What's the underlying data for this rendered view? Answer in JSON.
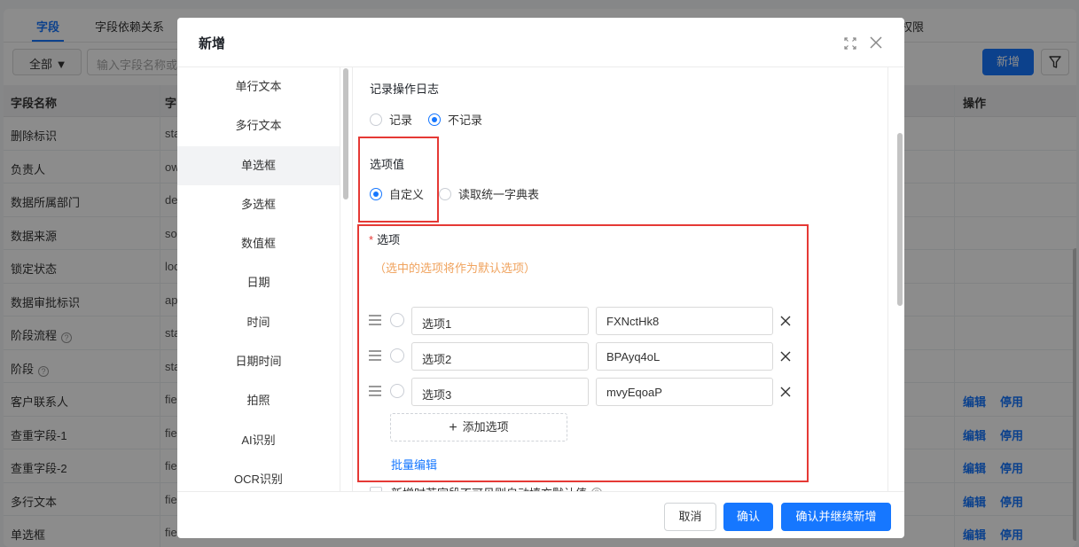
{
  "background": {
    "tabs": [
      "字段",
      "字段依赖关系"
    ],
    "right_tab": "权限",
    "filter_label": "全部 ▼",
    "search_placeholder": "输入字段名称或",
    "add_button": "新增",
    "columns": {
      "name": "字段名称",
      "key": "字",
      "action": "操作"
    },
    "rows": [
      {
        "name": "删除标识",
        "key": "sta",
        "help": false,
        "actions": []
      },
      {
        "name": "负责人",
        "key": "ow",
        "help": false,
        "actions": []
      },
      {
        "name": "数据所属部门",
        "key": "de",
        "help": false,
        "actions": []
      },
      {
        "name": "数据来源",
        "key": "so",
        "help": false,
        "actions": []
      },
      {
        "name": "锁定状态",
        "key": "loc",
        "help": false,
        "actions": []
      },
      {
        "name": "数据审批标识",
        "key": "ap",
        "help": false,
        "actions": []
      },
      {
        "name": "阶段流程",
        "key": "sta",
        "help": true,
        "actions": []
      },
      {
        "name": "阶段",
        "key": "sta",
        "help": true,
        "actions": []
      },
      {
        "name": "客户联系人",
        "key": "fie",
        "help": false,
        "actions": [
          "编辑",
          "停用"
        ]
      },
      {
        "name": "查重字段-1",
        "key": "fie",
        "help": false,
        "actions": [
          "编辑",
          "停用"
        ]
      },
      {
        "name": "查重字段-2",
        "key": "fie",
        "help": false,
        "actions": [
          "编辑",
          "停用"
        ]
      },
      {
        "name": "多行文本",
        "key": "fie",
        "help": false,
        "actions": [
          "编辑",
          "停用"
        ]
      },
      {
        "name": "单选框",
        "key": "fie",
        "help": false,
        "actions": [
          "编辑",
          "停用"
        ]
      }
    ]
  },
  "modal": {
    "title": "新增",
    "field_types": [
      "单行文本",
      "多行文本",
      "单选框",
      "多选框",
      "数值框",
      "日期",
      "时间",
      "日期时间",
      "拍照",
      "AI识别",
      "OCR识别"
    ],
    "active_type": "单选框",
    "log": {
      "label": "记录操作日志",
      "options": [
        "记录",
        "不记录"
      ],
      "selected": "不记录"
    },
    "option_source": {
      "label": "选项值",
      "options": [
        "自定义",
        "读取统一字典表"
      ],
      "selected": "自定义"
    },
    "options_section": {
      "required_mark": "*",
      "label": "选项",
      "hint": "（选中的选项将作为默认选项）",
      "items": [
        {
          "label": "选项1",
          "value": "FXNctHk8"
        },
        {
          "label": "选项2",
          "value": "BPAyq4oL"
        },
        {
          "label": "选项3",
          "value": "mvyEqoaP"
        }
      ],
      "add_label": "添加选项",
      "batch_edit": "批量编辑",
      "auto_fill_label": "新增时若字段不可见则自动填充默认值"
    },
    "footer": {
      "cancel": "取消",
      "confirm": "确认",
      "confirm_next": "确认并继续新增"
    }
  },
  "colors": {
    "primary": "#1677ff",
    "highlight": "#e53935",
    "hint": "#f0a35e"
  }
}
